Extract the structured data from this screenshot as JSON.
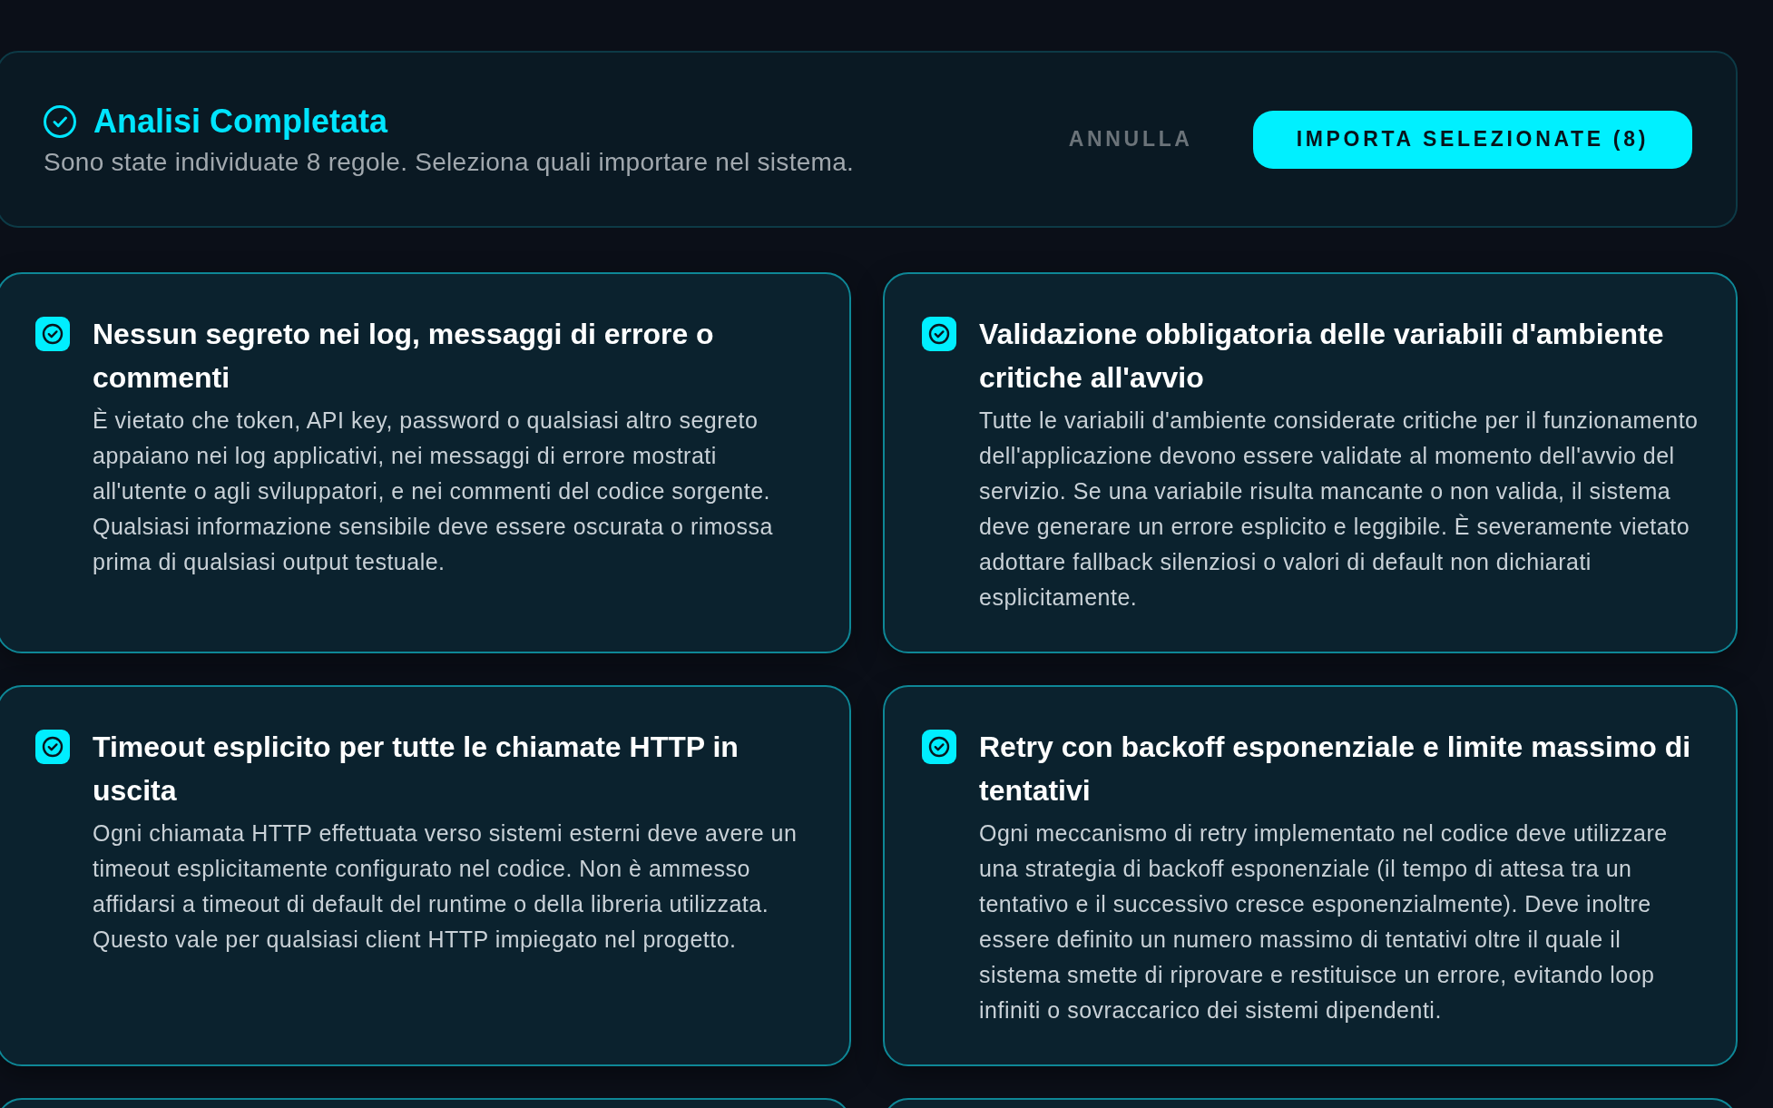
{
  "header": {
    "title": "Analisi Completata",
    "subtitle": "Sono state individuate 8 regole. Seleziona quali importare nel sistema.",
    "buttons": [
      {
        "label": "ANNULLA",
        "kind": "secondary"
      },
      {
        "label": "IMPORTA SELEZIONATE (8)",
        "kind": "primary"
      }
    ]
  },
  "cards": [
    {
      "title": "Nessun segreto nei log, messaggi di errore o commenti",
      "description": "È vietato che token, API key, password o qualsiasi altro segreto appaiano nei log applicativi, nei messaggi di errore mostrati all'utente o agli sviluppatori, e nei commenti del codice sorgente. Qualsiasi informazione sensibile deve essere oscurata o rimossa prima di qualsiasi output testuale.",
      "checked": true
    },
    {
      "title": "Validazione obbligatoria delle variabili d'ambiente critiche all'avvio",
      "description": "Tutte le variabili d'ambiente considerate critiche per il funzionamento dell'applicazione devono essere validate al momento dell'avvio del servizio. Se una variabile risulta mancante o non valida, il sistema deve generare un errore esplicito e leggibile. È severamente vietato adottare fallback silenziosi o valori di default non dichiarati esplicitamente.",
      "checked": true
    },
    {
      "title": "Timeout esplicito per tutte le chiamate HTTP in uscita",
      "description": "Ogni chiamata HTTP effettuata verso sistemi esterni deve avere un timeout esplicitamente configurato nel codice. Non è ammesso affidarsi a timeout di default del runtime o della libreria utilizzata. Questo vale per qualsiasi client HTTP impiegato nel progetto.",
      "checked": true
    },
    {
      "title": "Retry con backoff esponenziale e limite massimo di tentativi",
      "description": "Ogni meccanismo di retry implementato nel codice deve utilizzare una strategia di backoff esponenziale (il tempo di attesa tra un tentativo e il successivo cresce esponenzialmente). Deve inoltre essere definito un numero massimo di tentativi oltre il quale il sistema smette di riprovare e restituisce un errore, evitando loop infiniti o sovraccarico dei sistemi dipendenti.",
      "checked": true
    }
  ]
}
